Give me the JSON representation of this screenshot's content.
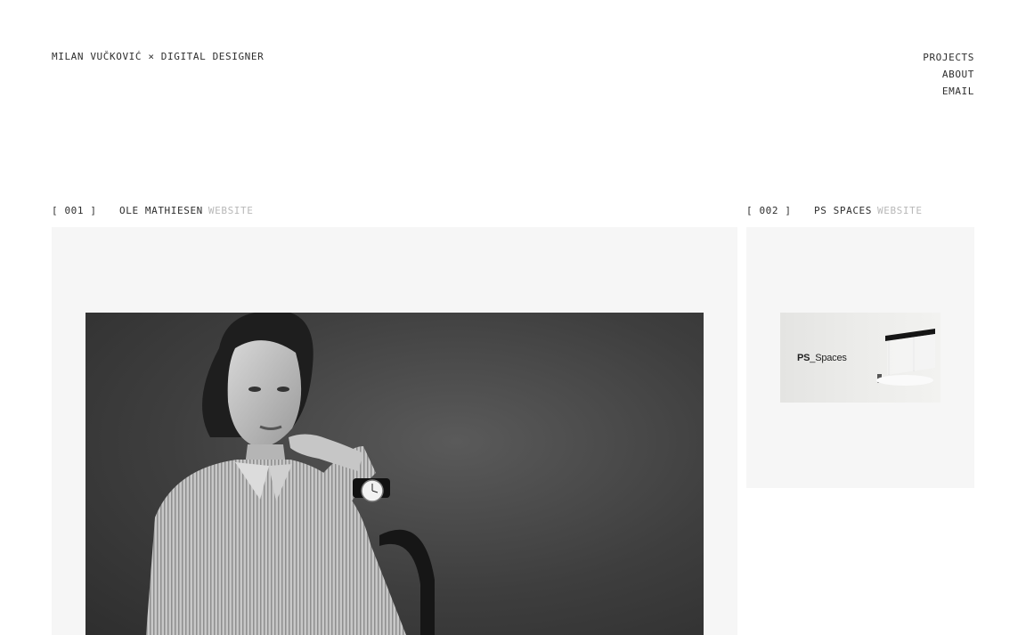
{
  "header": {
    "site_name": "MILAN VUČKOVIĆ × DIGITAL DESIGNER"
  },
  "nav": {
    "items": [
      {
        "label": "PROJECTS"
      },
      {
        "label": "ABOUT"
      },
      {
        "label": "EMAIL"
      }
    ]
  },
  "projects": [
    {
      "number": "[ 001 ]",
      "name": "OLE MATHIESEN",
      "type": "WEBSITE",
      "image": "portrait-photo"
    },
    {
      "number": "[ 002 ]",
      "name": "PS SPACES",
      "type": "WEBSITE",
      "image": "ps-spaces-thumbnail",
      "thumb_bold": "PS",
      "thumb_rest": "_Spaces"
    }
  ],
  "colors": {
    "background": "#ffffff",
    "card": "#f6f6f6",
    "text": "#2e2e2e",
    "muted": "#b8b8b8"
  }
}
